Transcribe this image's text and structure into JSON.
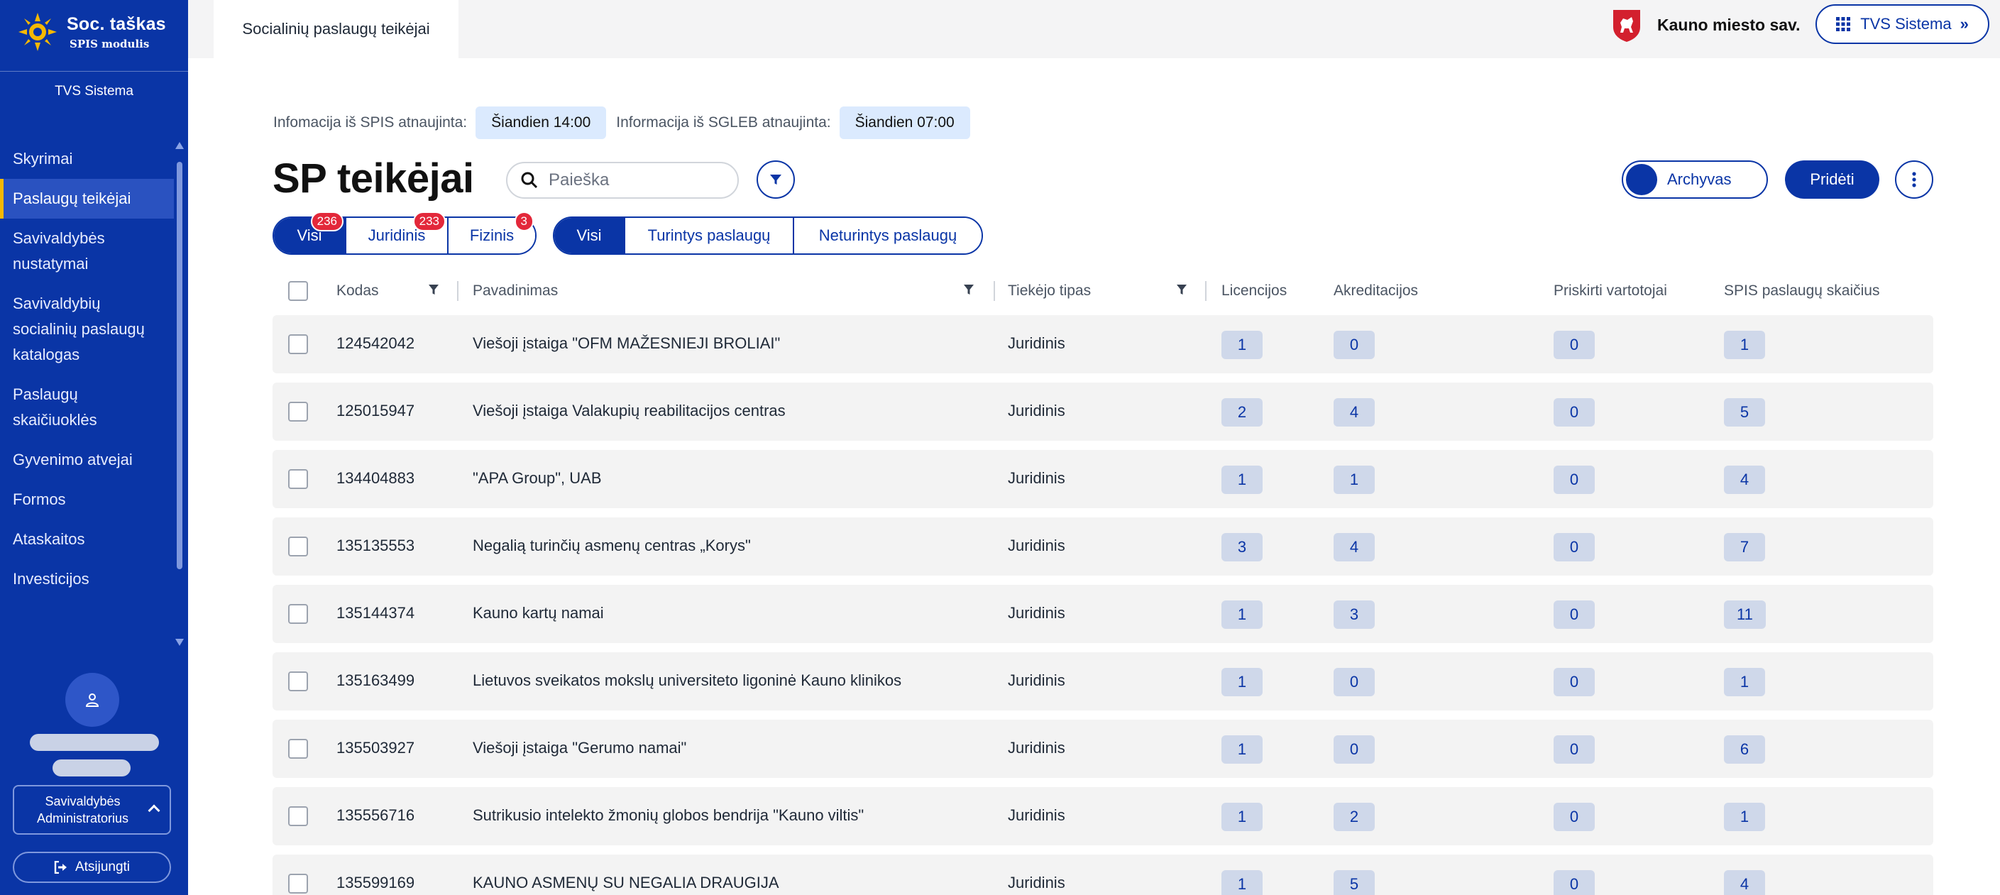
{
  "app": {
    "logo_title": "Soc. taškas",
    "logo_subtitle": "SPIS modulis",
    "system_name": "TVS Sistema"
  },
  "sidebar": {
    "items": [
      {
        "label": "Skyrimai",
        "active": false
      },
      {
        "label": "Paslaugų teikėjai",
        "active": true
      },
      {
        "label": "Savivaldybės nustatymai",
        "active": false
      },
      {
        "label": "Savivaldybių socialinių paslaugų katalogas",
        "active": false
      },
      {
        "label": "Paslaugų skaičiuoklės",
        "active": false
      },
      {
        "label": "Gyvenimo atvejai",
        "active": false
      },
      {
        "label": "Formos",
        "active": false
      },
      {
        "label": "Ataskaitos",
        "active": false
      },
      {
        "label": "Investicijos",
        "active": false
      }
    ],
    "role": "Savivaldybės Administratorius",
    "logout": "Atsijungti"
  },
  "topbar": {
    "tab": "Socialinių paslaugų teikėjai",
    "municipality": "Kauno miesto sav.",
    "system_button": "TVS Sistema"
  },
  "info": {
    "spis_label": "Infomacija iš SPIS atnaujinta:",
    "spis_value": "Šiandien 14:00",
    "sgleb_label": "Informacija iš SGLEB atnaujinta:",
    "sgleb_value": "Šiandien 07:00"
  },
  "page": {
    "title": "SP teikėjai",
    "search_placeholder": "Paieška",
    "archive_label": "Archyvas",
    "add_label": "Pridėti"
  },
  "type_filter": [
    {
      "label": "Visi",
      "count": "236",
      "active": true
    },
    {
      "label": "Juridinis",
      "count": "233",
      "active": false
    },
    {
      "label": "Fizinis",
      "count": "3",
      "active": false
    }
  ],
  "service_filter": [
    {
      "label": "Visi",
      "active": true
    },
    {
      "label": "Turintys paslaugų",
      "active": false
    },
    {
      "label": "Neturintys paslaugų",
      "active": false
    }
  ],
  "table": {
    "headers": {
      "code": "Kodas",
      "name": "Pavadinimas",
      "type": "Tiekėjo tipas",
      "licenses": "Licencijos",
      "accreditations": "Akreditacijos",
      "assigned_users": "Priskirti vartotojai",
      "spis_services": "SPIS paslaugų skaičius"
    },
    "rows": [
      {
        "code": "124542042",
        "name": "Viešoji įstaiga \"OFM MAŽESNIEJI BROLIAI\"",
        "type": "Juridinis",
        "licenses": "1",
        "accreditations": "0",
        "assigned_users": "0",
        "spis_services": "1"
      },
      {
        "code": "125015947",
        "name": "Viešoji įstaiga Valakupių reabilitacijos centras",
        "type": "Juridinis",
        "licenses": "2",
        "accreditations": "4",
        "assigned_users": "0",
        "spis_services": "5"
      },
      {
        "code": "134404883",
        "name": "\"APA Group\", UAB",
        "type": "Juridinis",
        "licenses": "1",
        "accreditations": "1",
        "assigned_users": "0",
        "spis_services": "4"
      },
      {
        "code": "135135553",
        "name": "Negalią turinčių asmenų centras „Korys\"",
        "type": "Juridinis",
        "licenses": "3",
        "accreditations": "4",
        "assigned_users": "0",
        "spis_services": "7"
      },
      {
        "code": "135144374",
        "name": "Kauno kartų namai",
        "type": "Juridinis",
        "licenses": "1",
        "accreditations": "3",
        "assigned_users": "0",
        "spis_services": "11"
      },
      {
        "code": "135163499",
        "name": "Lietuvos sveikatos mokslų universiteto ligoninė Kauno klinikos",
        "type": "Juridinis",
        "licenses": "1",
        "accreditations": "0",
        "assigned_users": "0",
        "spis_services": "1"
      },
      {
        "code": "135503927",
        "name": "Viešoji įstaiga \"Gerumo namai\"",
        "type": "Juridinis",
        "licenses": "1",
        "accreditations": "0",
        "assigned_users": "0",
        "spis_services": "6"
      },
      {
        "code": "135556716",
        "name": "Sutrikusio intelekto žmonių globos bendrija \"Kauno viltis\"",
        "type": "Juridinis",
        "licenses": "1",
        "accreditations": "2",
        "assigned_users": "0",
        "spis_services": "1"
      },
      {
        "code": "135599169",
        "name": "KAUNO ASMENŲ SU NEGALIA DRAUGIJA",
        "type": "Juridinis",
        "licenses": "1",
        "accreditations": "5",
        "assigned_users": "0",
        "spis_services": "4"
      }
    ]
  },
  "colors": {
    "primary": "#0a35a6",
    "accent": "#f6b800",
    "badge_red": "#e3283a",
    "info_badge": "#dbeafe",
    "pill": "#cfd8ea"
  },
  "icons": [
    "sun-logo-icon",
    "user-icon",
    "chevron-up-icon",
    "logout-icon",
    "coat-of-arms-icon",
    "grid-icon",
    "double-chevron-icon",
    "search-icon",
    "filter-icon",
    "more-vertical-icon"
  ]
}
